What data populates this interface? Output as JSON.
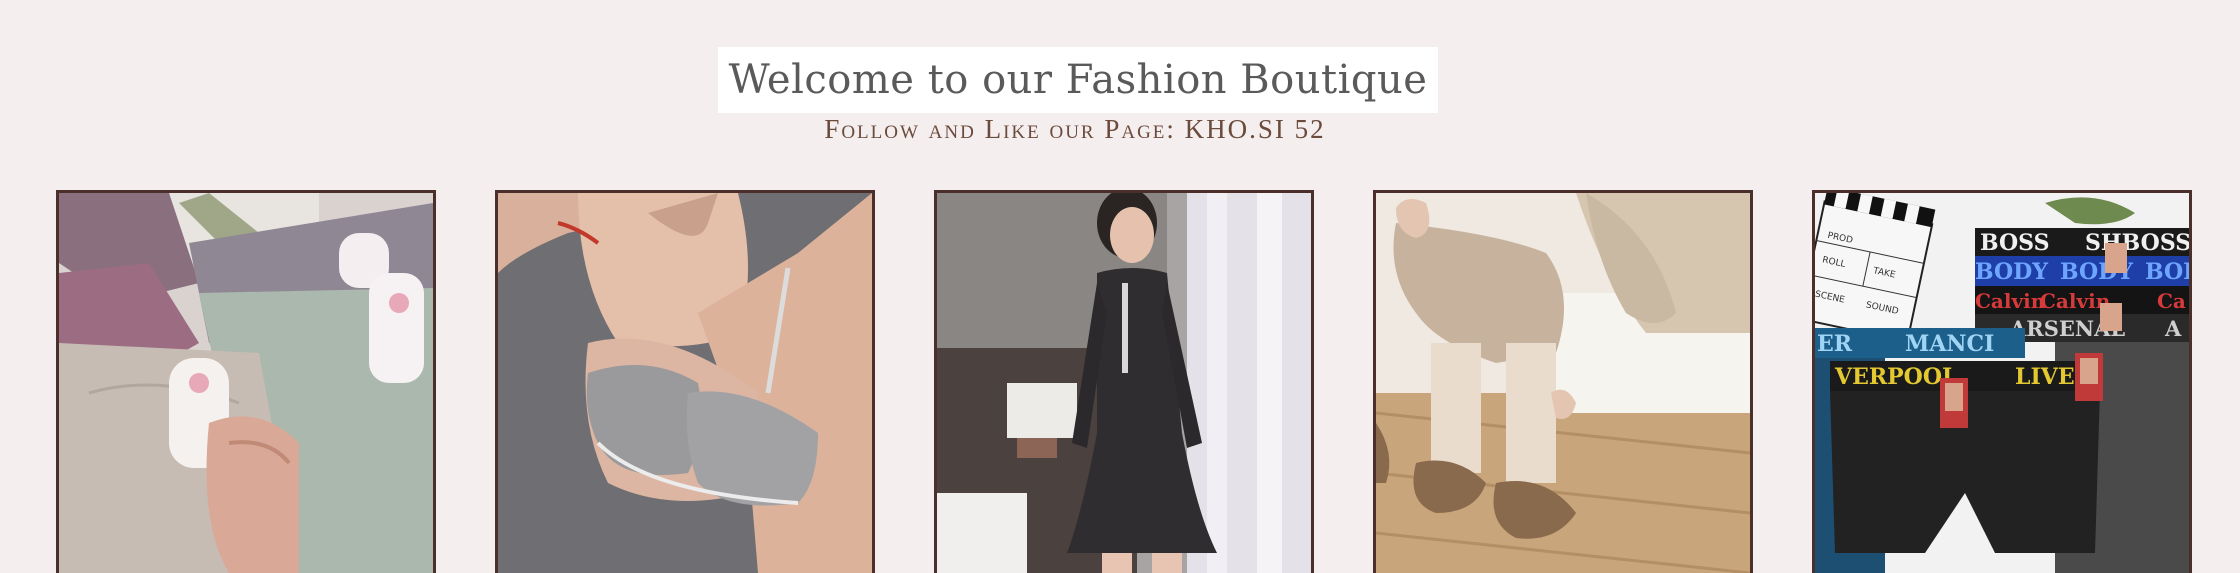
{
  "header": {
    "title": "Welcome to our Fashion Boutique",
    "subtitle": "Follow and Like our Page: KHO.SI 52"
  },
  "theme": {
    "background": "#f4eeee",
    "title_box": "#ffffff",
    "title_color": "#5a5a5a",
    "subtitle_color": "#6b4b3c",
    "frame_color": "#4a2f2a"
  },
  "gallery": {
    "items": [
      {
        "subject": "folded cotton panties with tags",
        "icon": "product-image"
      },
      {
        "subject": "grey bra",
        "icon": "product-image"
      },
      {
        "subject": "black sports dress",
        "icon": "product-image"
      },
      {
        "subject": "knit socks and slippers",
        "icon": "product-image"
      },
      {
        "subject": "men's boxer briefs",
        "waistband_texts": [
          "BOSS",
          "SHBOSS",
          "BODY",
          "BODY",
          "BODY",
          "Calvin",
          "Calvin",
          "Ca",
          "ARSENAL",
          "A",
          "ER",
          "MANCI",
          "VERPOOL",
          "LIVE"
        ],
        "clapper_texts": [
          "PROD",
          "ROLL",
          "TAKE",
          "SCENE",
          "SOUND"
        ],
        "icon": "product-image"
      }
    ]
  }
}
